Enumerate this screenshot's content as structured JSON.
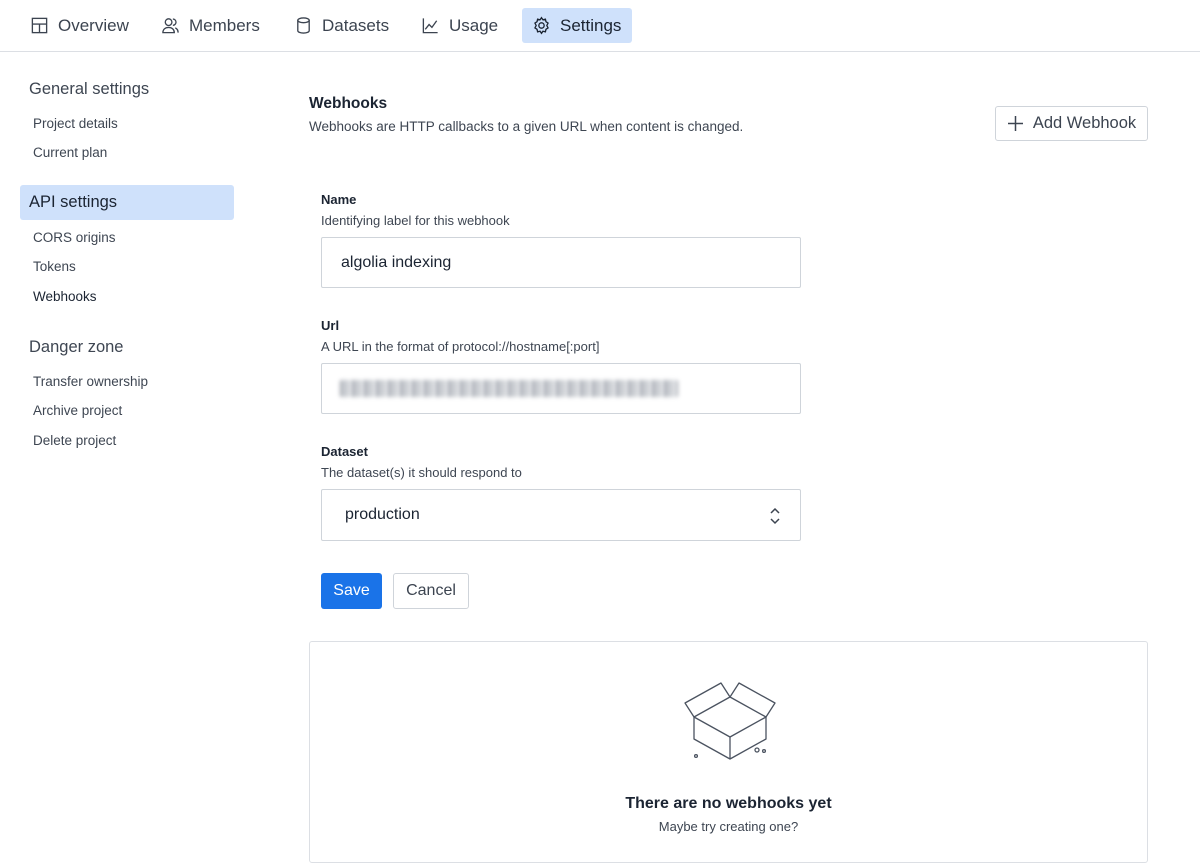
{
  "nav": {
    "tabs": [
      {
        "label": "Overview",
        "icon": "overview-grid-icon"
      },
      {
        "label": "Members",
        "icon": "members-icon"
      },
      {
        "label": "Datasets",
        "icon": "database-icon"
      },
      {
        "label": "Usage",
        "icon": "chart-line-icon"
      },
      {
        "label": "Settings",
        "icon": "gear-icon",
        "active": true
      }
    ]
  },
  "sidebar": {
    "general_heading": "General settings",
    "general_items": [
      "Project details",
      "Current plan"
    ],
    "api_heading": "API settings",
    "api_items": [
      "CORS origins",
      "Tokens",
      "Webhooks"
    ],
    "danger_heading": "Danger zone",
    "danger_items": [
      "Transfer ownership",
      "Archive project",
      "Delete project"
    ]
  },
  "webhooks": {
    "title": "Webhooks",
    "description": "Webhooks are HTTP callbacks to a given URL when content is changed.",
    "add_button": "Add Webhook"
  },
  "form": {
    "name_label": "Name",
    "name_help": "Identifying label for this webhook",
    "name_value": "algolia indexing",
    "url_label": "Url",
    "url_help": "A URL in the format of protocol://hostname[:port]",
    "dataset_label": "Dataset",
    "dataset_help": "The dataset(s) it should respond to",
    "dataset_value": "production",
    "save_button": "Save",
    "cancel_button": "Cancel"
  },
  "empty_state": {
    "title": "There are no webhooks yet",
    "subtitle": "Maybe try creating one?"
  },
  "colors": {
    "accent": "#1a73e8",
    "active_background": "#cfe1fb",
    "border": "#cfd4da"
  }
}
